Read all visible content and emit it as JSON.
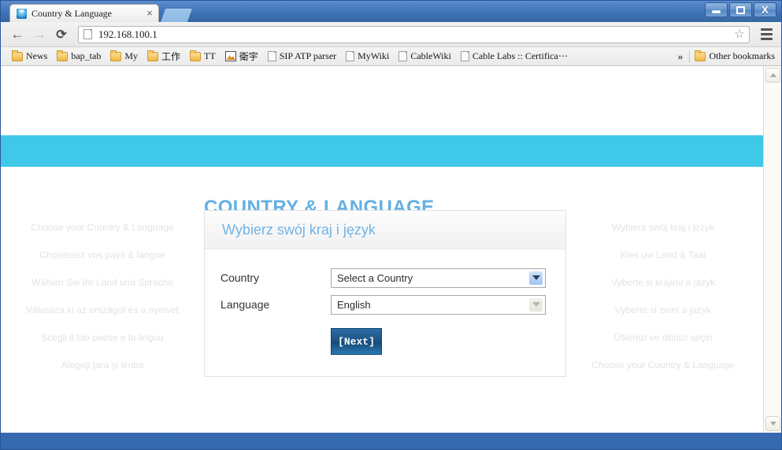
{
  "window": {
    "controls": {
      "minimize": "minimize",
      "maximize": "restore",
      "close": "X"
    }
  },
  "tab": {
    "title": "Country & Language",
    "close_label": "×"
  },
  "toolbar": {
    "back": "←",
    "forward": "→",
    "reload": "⟳",
    "url": "192.168.100.1",
    "star": "☆",
    "menu": "menu"
  },
  "bookmarks": {
    "items": [
      {
        "label": "News",
        "icon": "folder"
      },
      {
        "label": "bap_tab",
        "icon": "folder"
      },
      {
        "label": "My",
        "icon": "folder"
      },
      {
        "label": "工作",
        "icon": "folder"
      },
      {
        "label": "TT",
        "icon": "folder"
      },
      {
        "label": "衛宇",
        "icon": "image"
      },
      {
        "label": "SIP ATP parser",
        "icon": "doc"
      },
      {
        "label": "MyWiki",
        "icon": "doc"
      },
      {
        "label": "CableWiki",
        "icon": "doc"
      },
      {
        "label": "Cable Labs :: Certifica⋯",
        "icon": "doc"
      }
    ],
    "overflow": "»",
    "other": {
      "label": "Other bookmarks",
      "icon": "folder"
    }
  },
  "page": {
    "title": "COUNTRY & LANGUAGE",
    "banner_color": "#3fc8e8",
    "title_color": "#63b0e3",
    "left_column": [
      "Choose your Country & Language",
      "Choisissez vos pays & langue",
      "Wählen Sie Ihr Land und Sprache",
      "Válassza ki az országot és a nyelvet",
      "Scegli il tuo paese e la lingua",
      "Alegeţi ţara şi limba"
    ],
    "right_column": [
      "Wybierz swój kraj i język",
      "Kies uw Land & Taal",
      "Vyberte si krajinu a jazyk",
      "Vyberte si zemi a jazyk",
      "Ülkenizi ve dilinizi seçin",
      "Choose your Country & Language"
    ],
    "panel": {
      "header": "Wybierz swój kraj i język",
      "country_label": "Country",
      "country_value": "Select a Country",
      "language_label": "Language",
      "language_value": "English",
      "next_label": "[Next]"
    }
  }
}
